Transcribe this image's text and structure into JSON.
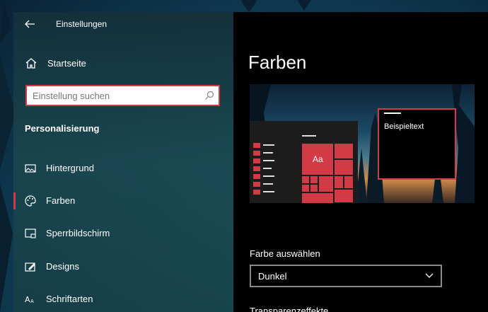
{
  "window": {
    "title": "Einstellungen"
  },
  "sidebar": {
    "home_label": "Startseite",
    "search": {
      "placeholder": "Einstellung suchen",
      "value": ""
    },
    "section_title": "Personalisierung",
    "items": [
      {
        "label": "Hintergrund",
        "icon": "image-icon",
        "active": false
      },
      {
        "label": "Farben",
        "icon": "palette-icon",
        "active": true
      },
      {
        "label": "Sperrbildschirm",
        "icon": "lockscreen-icon",
        "active": false
      },
      {
        "label": "Designs",
        "icon": "brush-icon",
        "active": false
      },
      {
        "label": "Schriftarten",
        "icon": "font-icon",
        "active": false
      }
    ]
  },
  "main": {
    "page_title": "Farben",
    "preview": {
      "tile_text": "Aa",
      "sample_text": "Beispieltext"
    },
    "color_select": {
      "label": "Farbe auswählen",
      "value": "Dunkel"
    },
    "next_section_label": "Transparenzeffekte"
  },
  "colors": {
    "accent": "#d23a46",
    "content_bg": "#000000",
    "sidebar_bg": "#1a4650"
  }
}
